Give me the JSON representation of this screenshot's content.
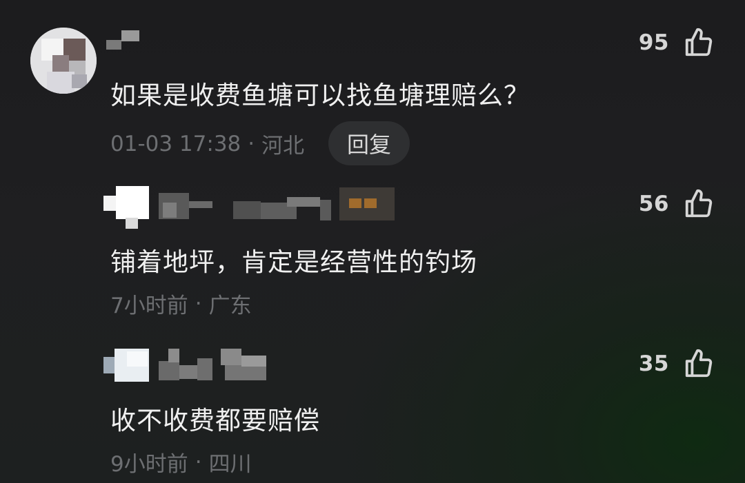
{
  "comments": [
    {
      "text": "如果是收费鱼塘可以找鱼塘理赔么？",
      "time": "01-03 17:38",
      "separator": "·",
      "location": "河北",
      "likes": "95",
      "reply_label": "回复"
    },
    {
      "text": "铺着地坪，肯定是经营性的钓场",
      "time": "7小时前",
      "separator": "·",
      "location": "广东",
      "likes": "56"
    },
    {
      "text": "收不收费都要赔偿",
      "time": "9小时前",
      "separator": "·",
      "location": "四川",
      "likes": "35"
    }
  ],
  "icons": {
    "like": "thumbs-up-icon"
  },
  "colors": {
    "text": "#f0f0f0",
    "meta": "#6d6f72",
    "like_count": "#d6d6d6",
    "reply_bg": "#2e2f31",
    "background": "#1c1c1e"
  }
}
